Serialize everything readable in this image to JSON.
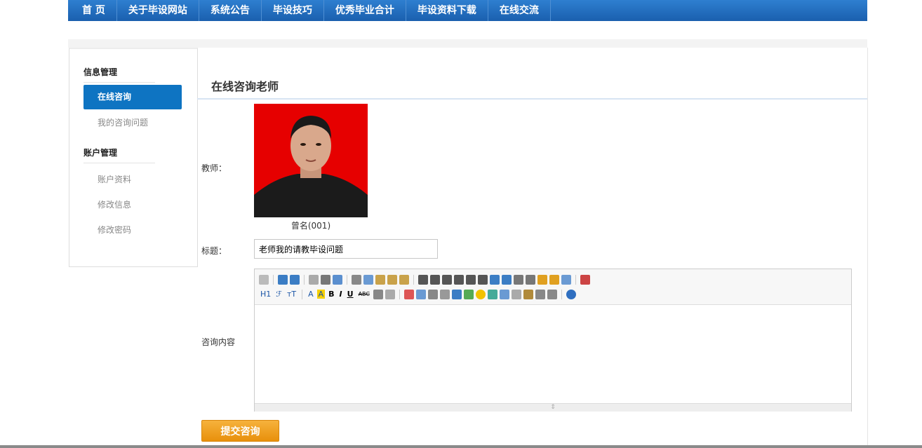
{
  "nav": {
    "items": [
      "首 页",
      "关于毕设网站",
      "系统公告",
      "毕设技巧",
      "优秀毕业合计",
      "毕设资料下载",
      "在线交流"
    ]
  },
  "sidebar": {
    "groups": [
      {
        "title": "信息管理",
        "items": [
          "在线咨询",
          "我的咨询问题"
        ],
        "active_index": 0
      },
      {
        "title": "账户管理",
        "items": [
          "账户资料",
          "修改信息",
          "修改密码"
        ]
      }
    ]
  },
  "main": {
    "title": "在线咨询老师",
    "teacher_label": "教师：",
    "teacher_name": "曾名(001)",
    "subject_label": "标题：",
    "subject_value": "老师我的请教毕设问题",
    "content_label": "咨询内容",
    "submit_label": "提交咨询"
  },
  "editor": {
    "heading_button": "H1",
    "font_button": "ℱ",
    "size_button": "тT",
    "font_color_button": "A",
    "bg_color_button": "A",
    "bold": "B",
    "italic": "I",
    "underline": "U",
    "strike": "ABC"
  },
  "colors": {
    "nav_bg": "#1a5fae",
    "active_item": "#0e74c2",
    "submit": "#f0a020",
    "photo_bg": "#e60000"
  }
}
